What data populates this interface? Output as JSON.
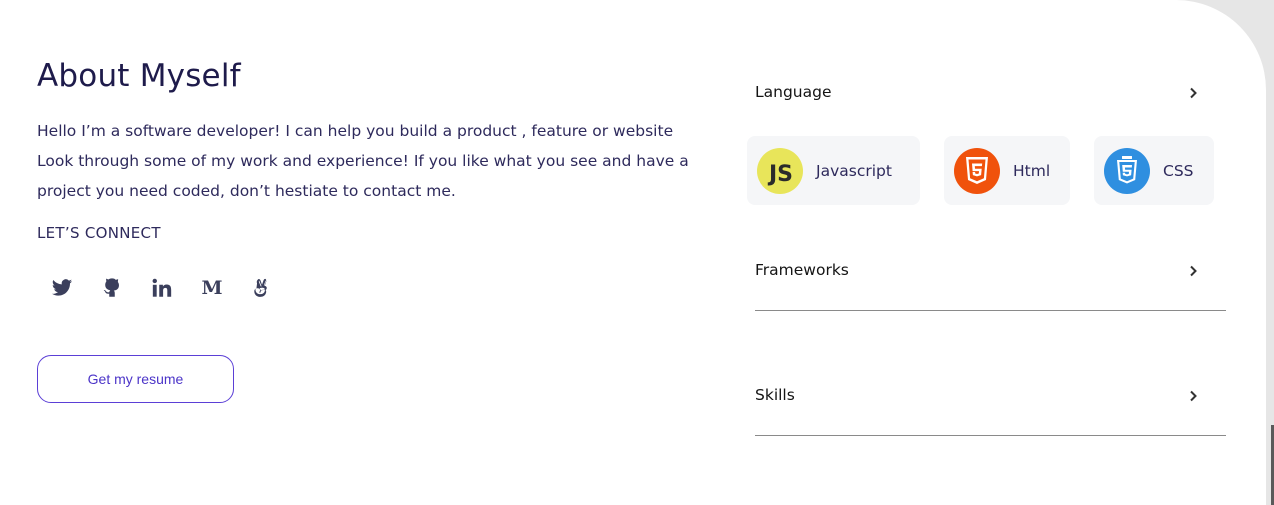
{
  "about": {
    "title": "About Myself",
    "intro": "Hello I’m a software developer! I can help you build a product , feature or website Look through some of my work and experience! If you like what you see and have a project you need coded, don’t hestiate to contact me.",
    "connect_label": "LET’S CONNECT",
    "socials": [
      {
        "icon": "twitter-icon"
      },
      {
        "icon": "github-icon"
      },
      {
        "icon": "linkedin-icon"
      },
      {
        "icon": "medium-icon",
        "glyph": "M"
      },
      {
        "icon": "angellist-icon"
      }
    ],
    "resume_label": "Get my resume"
  },
  "skills_panel": {
    "language": {
      "label": "Language",
      "items": [
        {
          "name": "Javascript",
          "logo_text": "JS",
          "color": "#e8e55a"
        },
        {
          "name": "Html",
          "color": "#f0520c"
        },
        {
          "name": "CSS",
          "color": "#2f8fe0"
        }
      ]
    },
    "frameworks": {
      "label": "Frameworks"
    },
    "skills": {
      "label": "Skills"
    }
  },
  "colors": {
    "accent": "#5b3fd6",
    "heading": "#1e1b4b",
    "text": "#2e2a5c"
  }
}
